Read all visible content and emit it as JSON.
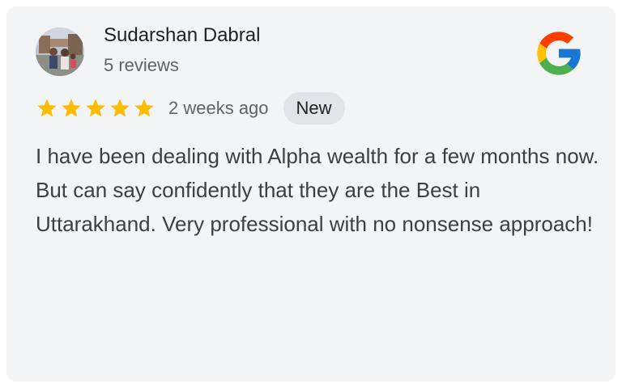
{
  "review": {
    "author_name": "Sudarshan Dabral",
    "review_count": "5 reviews",
    "rating": 5,
    "max_rating": 5,
    "time_ago": "2 weeks ago",
    "badge": "New",
    "text": "I have been dealing with Alpha wealth for a few months now. But can say confidently that they are the Best in Uttarakhand. Very professional with no nonsense approach!"
  },
  "icons": {
    "avatar": "avatar-photo",
    "logo": "google-g-icon",
    "star": "star-icon"
  },
  "colors": {
    "card_background": "#f3f4f6",
    "star": "#fbbc04",
    "badge_background": "#e3e4e8",
    "google_blue": "#4285f4",
    "google_red": "#ea4335",
    "google_yellow": "#fbbc05",
    "google_green": "#34a853"
  }
}
